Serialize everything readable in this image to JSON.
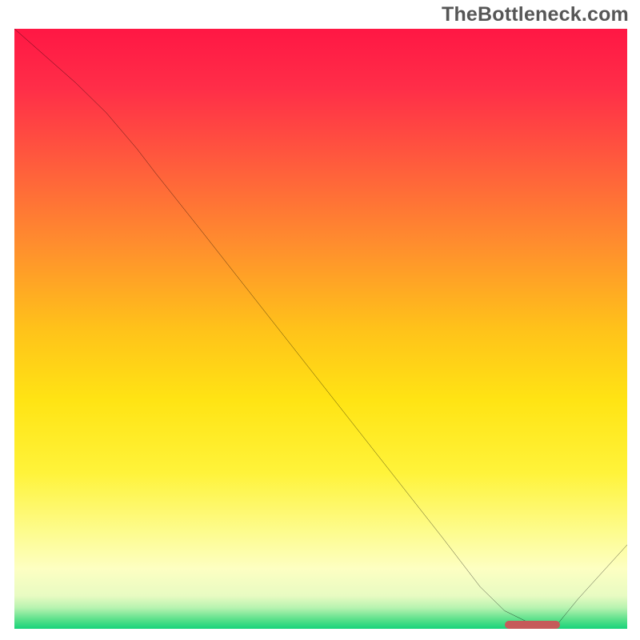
{
  "attribution": "TheBottleneck.com",
  "colors": {
    "gradient_stops": [
      {
        "offset": 0.0,
        "color": "#ff1744"
      },
      {
        "offset": 0.1,
        "color": "#ff2e48"
      },
      {
        "offset": 0.22,
        "color": "#ff5a3d"
      },
      {
        "offset": 0.35,
        "color": "#ff8a2f"
      },
      {
        "offset": 0.5,
        "color": "#ffc21a"
      },
      {
        "offset": 0.62,
        "color": "#ffe414"
      },
      {
        "offset": 0.74,
        "color": "#fff33a"
      },
      {
        "offset": 0.84,
        "color": "#fdfc8f"
      },
      {
        "offset": 0.9,
        "color": "#fdffc2"
      },
      {
        "offset": 0.945,
        "color": "#e8fbc2"
      },
      {
        "offset": 0.965,
        "color": "#b7f3b0"
      },
      {
        "offset": 0.985,
        "color": "#58e08a"
      },
      {
        "offset": 1.0,
        "color": "#18d37a"
      }
    ],
    "curve": "#000000",
    "marker": "#c65a5a"
  },
  "chart_data": {
    "type": "line",
    "title": "",
    "xlabel": "",
    "ylabel": "",
    "xlim": [
      0,
      100
    ],
    "ylim": [
      0,
      100
    ],
    "grid": false,
    "legend": false,
    "x": [
      0,
      5,
      10,
      15,
      20,
      23,
      30,
      40,
      50,
      60,
      70,
      76,
      80,
      84,
      88,
      92,
      100
    ],
    "y": [
      100,
      95.5,
      91,
      86,
      80,
      76,
      67,
      54,
      41,
      28,
      15,
      7,
      3,
      1,
      0,
      5,
      14
    ],
    "optimal_range": {
      "x_start": 80,
      "x_end": 89,
      "y": 0.7
    }
  }
}
